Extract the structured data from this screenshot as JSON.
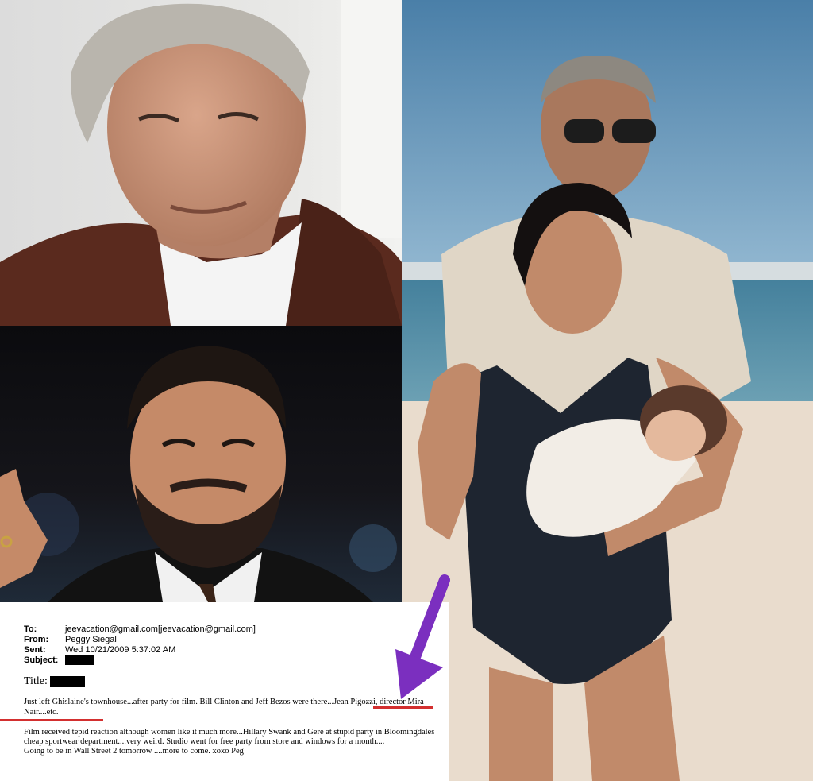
{
  "email": {
    "to_label": "To:",
    "to_value": "jeevacation@gmail.com[jeevacation@gmail.com]",
    "from_label": "From:",
    "from_value": "Peggy Siegal",
    "sent_label": "Sent:",
    "sent_value": "Wed 10/21/2009 5:37:02 AM",
    "subject_label": "Subject:",
    "title_label": "Title:",
    "line1": "Just left Ghislaine's townhouse...after party for film.  Bill Clinton and Jeff Bezos were there...Jean Pigozzi, director Mira",
    "line2": "Nair....etc.",
    "line3": "Film received tepid reaction although women like it much more...Hillary Swank and Gere at stupid party in Bloomingdales",
    "line4": "cheap sportwear department....very weird.  Studio went for free party from store and windows for a month....",
    "line5": "Going to be in Wall Street 2 tomorrow ....more to come. xoxo Peg"
  },
  "colors": {
    "arrow": "#7b2fbf",
    "underline": "#d32f2f"
  }
}
